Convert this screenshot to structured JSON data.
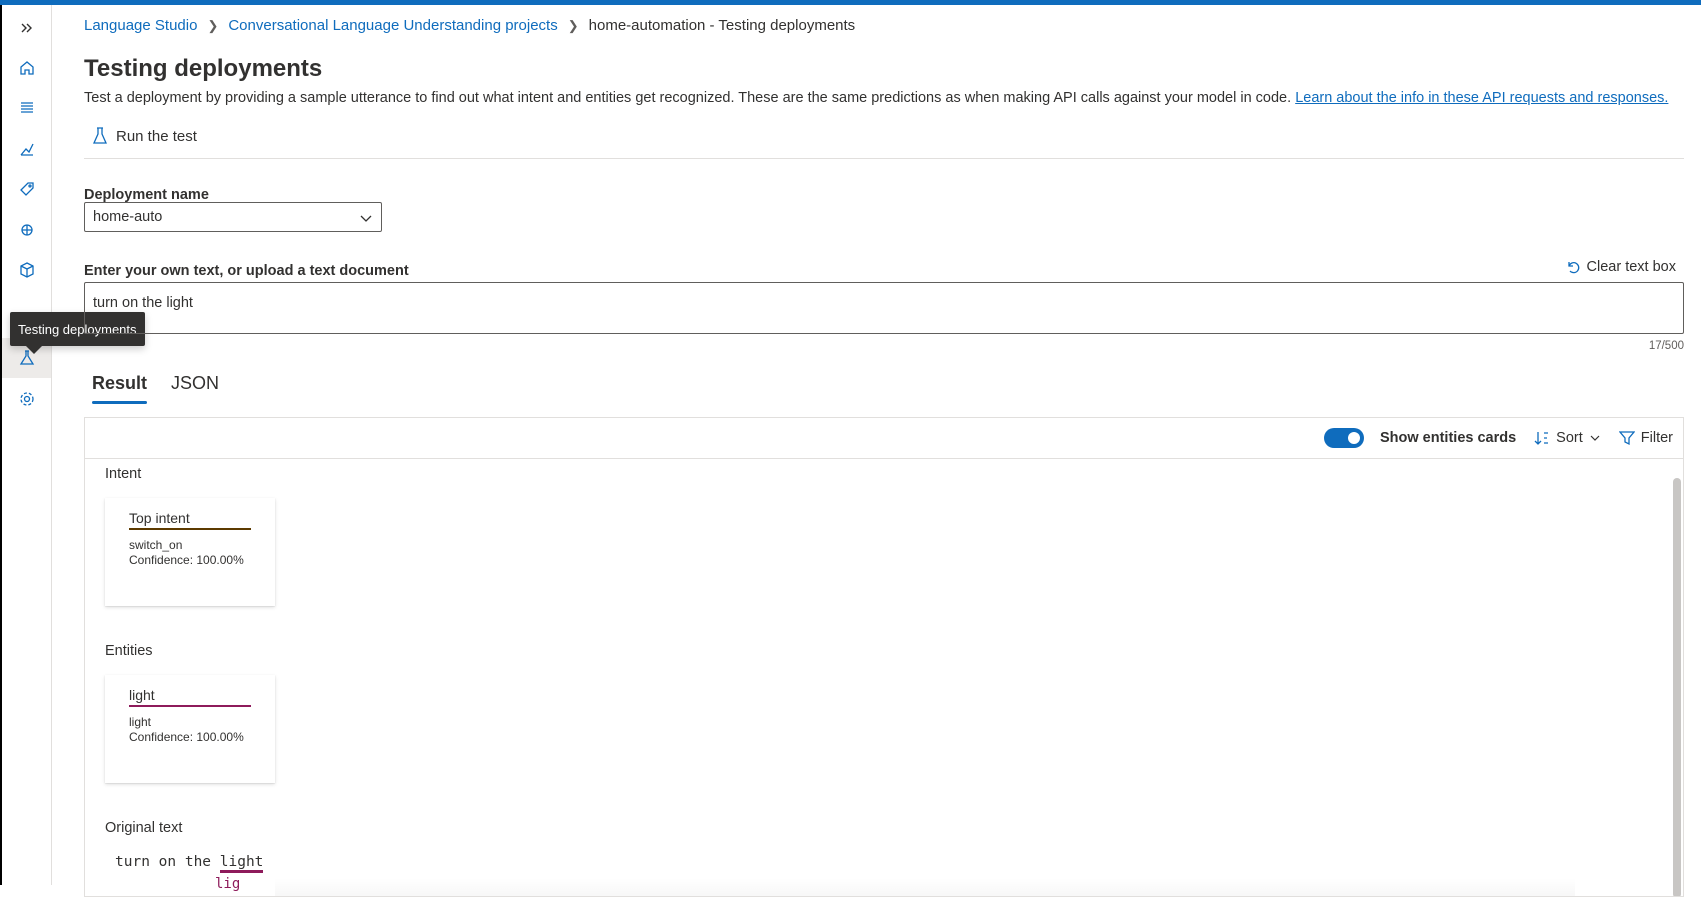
{
  "tooltip": "Testing deployments",
  "breadcrumb": {
    "items": [
      "Language Studio",
      "Conversational Language Understanding projects"
    ],
    "current": "home-automation - Testing deployments"
  },
  "page": {
    "title": "Testing deployments",
    "description": "Test a deployment by providing a sample utterance to find out what intent and entities get recognized. These are the same predictions as when making API calls against your model in code.",
    "learn_link": "Learn about the info in these API requests and responses."
  },
  "command": {
    "run_label": "Run the test"
  },
  "deployment": {
    "label": "Deployment name",
    "value": "home-auto"
  },
  "input": {
    "label": "Enter your own text, or upload a text document",
    "clear_label": "Clear text box",
    "value": "turn on the light",
    "counter": "17/500"
  },
  "tabs": [
    {
      "label": "Result"
    },
    {
      "label": "JSON"
    }
  ],
  "toolbar": {
    "show_entities_label": "Show entities cards",
    "sort_label": "Sort",
    "filter_label": "Filter"
  },
  "intent": {
    "section": "Intent",
    "card_title": "Top intent",
    "name": "switch_on",
    "confidence": "Confidence: 100.00%"
  },
  "entities": {
    "section": "Entities",
    "card_title": "light",
    "name": "light",
    "confidence": "Confidence: 100.00%"
  },
  "original": {
    "section": "Original text",
    "prefix": "turn on the ",
    "entity": "light",
    "entity_tag": "lig"
  },
  "colors": {
    "accent": "#0f6cbd",
    "entity": "#8e1b5b",
    "intent": "#5c3a00"
  }
}
